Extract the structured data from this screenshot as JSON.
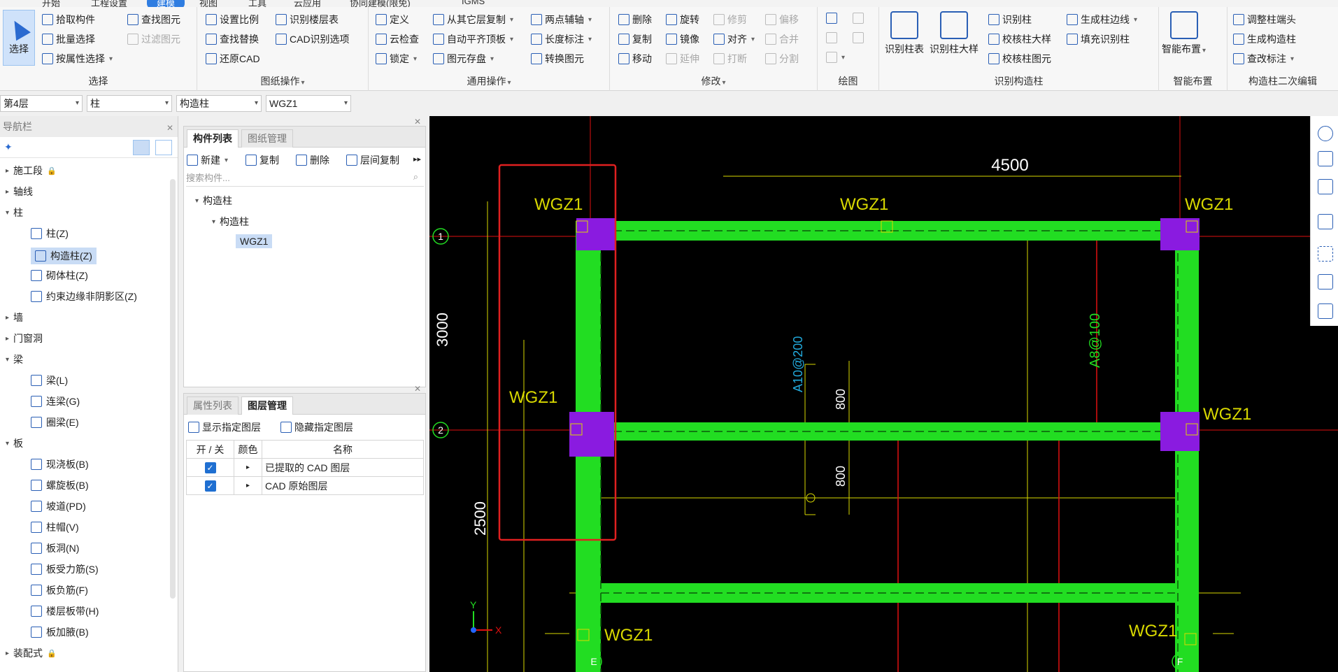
{
  "top_tabs": [
    "开始",
    "工程设置",
    "建模",
    "视图",
    "工具",
    "云应用",
    "协同建模(限免)",
    "IGMS"
  ],
  "top_tabs_active": 2,
  "ribbon": {
    "select_group": {
      "title": "选择",
      "select_button": "选择",
      "pick_component": "拾取构件",
      "batch_select": "批量选择",
      "select_by_attr": "按属性选择",
      "find_element": "查找图元",
      "filter_element": "过滤图元"
    },
    "drawing_group": {
      "title": "图纸操作",
      "set_scale": "设置比例",
      "identify_floor_table": "识别楼层表",
      "find_replace": "查找替换",
      "cad_identify_options": "CAD识别选项",
      "restore_cad": "还原CAD"
    },
    "general_group": {
      "title": "通用操作",
      "define": "定义",
      "copy_from_other": "从其它层复制",
      "two_point_axis": "两点辅轴",
      "cloud_check": "云检查",
      "auto_align_top": "自动平齐顶板",
      "length_dim": "长度标注",
      "lock": "锁定",
      "save_element": "图元存盘",
      "convert_element": "转换图元"
    },
    "modify_group": {
      "title": "修改",
      "delete": "删除",
      "rotate": "旋转",
      "trim": "修剪",
      "offset": "偏移",
      "copy": "复制",
      "mirror": "镜像",
      "align": "对齐",
      "merge": "合并",
      "move": "移动",
      "extend": "延伸",
      "break": "打断",
      "split": "分割"
    },
    "draw_group": {
      "title": "绘图"
    },
    "identify_group": {
      "title": "识别构造柱",
      "identify_column_table": "识别柱表",
      "identify_column_detail": "识别柱大样",
      "identify_column": "识别柱",
      "generate_edge": "生成柱边线",
      "check_column_detail": "校核柱大样",
      "fill_identify": "填充识别柱",
      "check_column_element": "校核柱图元"
    },
    "smart_group": {
      "title": "智能布置",
      "smart_layout": "智能布置"
    },
    "secondary_group": {
      "title": "构造柱二次编辑",
      "adjust_end": "调整柱端头",
      "generate_column": "生成构造柱",
      "modify_label": "查改标注"
    }
  },
  "filters": {
    "floor": "第4层",
    "category": "柱",
    "type": "构造柱",
    "component": "WGZ1"
  },
  "nav": {
    "title": "导航栏",
    "items": [
      {
        "label": "施工段",
        "level": 0,
        "expanded": false,
        "lock": true
      },
      {
        "label": "轴线",
        "level": 0,
        "expanded": false
      },
      {
        "label": "柱",
        "level": 0,
        "expanded": true
      },
      {
        "label": "柱(Z)",
        "level": 1
      },
      {
        "label": "构造柱(Z)",
        "level": 1,
        "selected": true
      },
      {
        "label": "砌体柱(Z)",
        "level": 1
      },
      {
        "label": "约束边缘非阴影区(Z)",
        "level": 1
      },
      {
        "label": "墙",
        "level": 0,
        "expanded": false
      },
      {
        "label": "门窗洞",
        "level": 0,
        "expanded": false
      },
      {
        "label": "梁",
        "level": 0,
        "expanded": true
      },
      {
        "label": "梁(L)",
        "level": 1
      },
      {
        "label": "连梁(G)",
        "level": 1
      },
      {
        "label": "圈梁(E)",
        "level": 1
      },
      {
        "label": "板",
        "level": 0,
        "expanded": true
      },
      {
        "label": "现浇板(B)",
        "level": 1
      },
      {
        "label": "螺旋板(B)",
        "level": 1
      },
      {
        "label": "坡道(PD)",
        "level": 1
      },
      {
        "label": "柱帽(V)",
        "level": 1
      },
      {
        "label": "板洞(N)",
        "level": 1
      },
      {
        "label": "板受力筋(S)",
        "level": 1
      },
      {
        "label": "板负筋(F)",
        "level": 1
      },
      {
        "label": "楼层板带(H)",
        "level": 1
      },
      {
        "label": "板加腋(B)",
        "level": 1
      },
      {
        "label": "装配式",
        "level": 0,
        "expanded": false,
        "lock": true
      }
    ]
  },
  "component_panel": {
    "tabs": [
      "构件列表",
      "图纸管理"
    ],
    "active_tab": 0,
    "toolbar": {
      "new": "新建",
      "copy": "复制",
      "delete": "删除",
      "floor_copy": "层间复制"
    },
    "search_placeholder": "搜索构件...",
    "tree": {
      "root": "构造柱",
      "child": "构造柱",
      "leaf": "WGZ1"
    }
  },
  "layer_panel": {
    "tabs": [
      "属性列表",
      "图层管理"
    ],
    "active_tab": 1,
    "show_layer": "显示指定图层",
    "hide_layer": "隐藏指定图层",
    "headers": [
      "开 / 关",
      "颜色",
      "名称"
    ],
    "rows": [
      {
        "on": true,
        "name": "已提取的 CAD 图层"
      },
      {
        "on": true,
        "name": "CAD 原始图层"
      }
    ]
  },
  "canvas": {
    "labels": {
      "wgz_a": "WGZ1",
      "wgz_b": "WGZ1",
      "wgz_c": "WGZ1",
      "wgz_d": "WGZ1",
      "wgz_e": "WGZ1",
      "wgz_f": "WGZ1",
      "wgz_g": "WGZ1"
    },
    "dims": {
      "top": "4500",
      "left_a": "3000",
      "left_b": "2500",
      "v800a": "800",
      "v800b": "800"
    },
    "rebar": {
      "a": "A8@100",
      "b": "A10@200"
    },
    "axes": {
      "row1": "1",
      "row2": "2",
      "colE": "E",
      "colF": "F"
    },
    "ucs": {
      "x": "X",
      "y": "Y"
    }
  },
  "colors": {
    "accent": "#2f7de1",
    "beam": "#22dd22",
    "column": "#8a1be0",
    "cad_line": "#d9d900",
    "selection": "#e02020"
  }
}
